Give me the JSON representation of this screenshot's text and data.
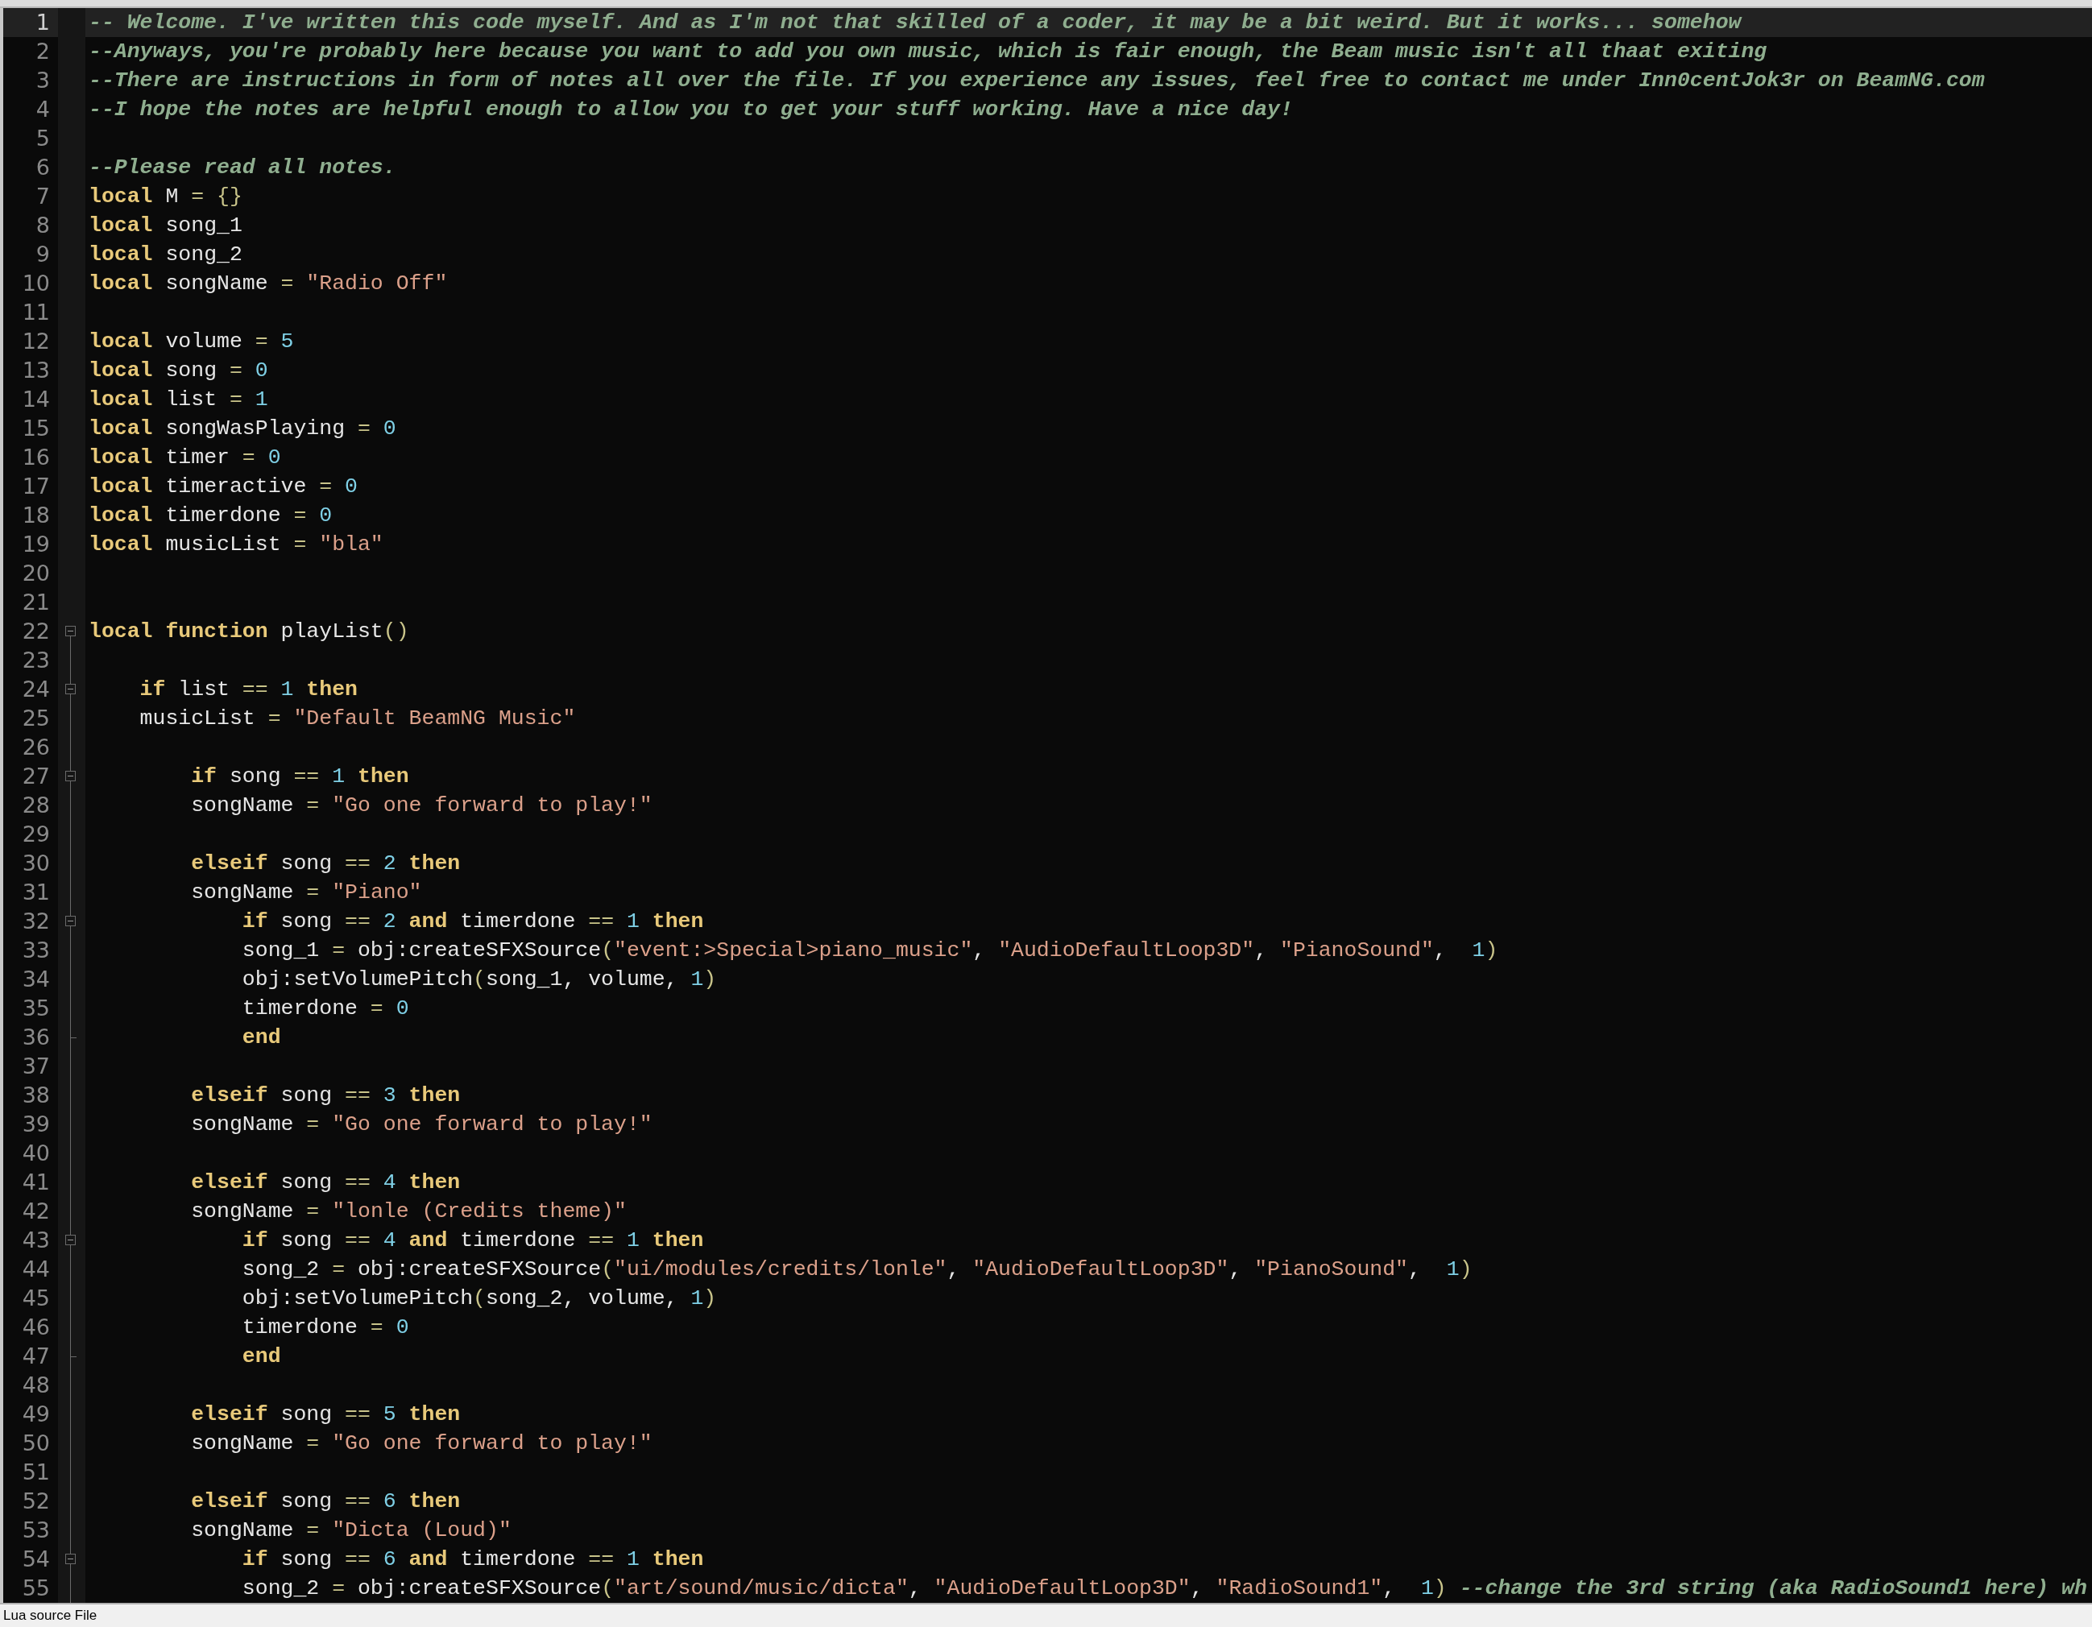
{
  "editor": {
    "lines": [
      {
        "number": "1",
        "current": true,
        "tokens": [
          {
            "kind": "comment",
            "text": "-- Welcome. I've written this code myself. And as I'm not that skilled of a coder, it may be a bit weird. But it works... somehow"
          }
        ]
      },
      {
        "number": "2",
        "current": false,
        "tokens": [
          {
            "kind": "comment",
            "text": "--Anyways, you're probably here because you want to add you own music, which is fair enough, the Beam music isn't all thaat exiting"
          }
        ]
      },
      {
        "number": "3",
        "current": false,
        "tokens": [
          {
            "kind": "comment",
            "text": "--There are instructions in form of notes all over the file. If you experience any issues, feel free to contact me under Inn0centJok3r on BeamNG.com"
          }
        ]
      },
      {
        "number": "4",
        "current": false,
        "tokens": [
          {
            "kind": "comment",
            "text": "--I hope the notes are helpful enough to allow you to get your stuff working. Have a nice day!"
          }
        ]
      },
      {
        "number": "5",
        "current": false
      },
      {
        "number": "6",
        "current": false,
        "tokens": [
          {
            "kind": "comment",
            "text": "--Please read all notes."
          }
        ]
      },
      {
        "number": "7",
        "current": false,
        "tokens": [
          {
            "kind": "keyword",
            "text": "local"
          },
          {
            "kind": "plain",
            "text": " M "
          },
          {
            "kind": "operator",
            "text": "= {}"
          }
        ]
      },
      {
        "number": "8",
        "current": false,
        "tokens": [
          {
            "kind": "keyword",
            "text": "local"
          },
          {
            "kind": "plain",
            "text": " song_1"
          }
        ]
      },
      {
        "number": "9",
        "current": false,
        "tokens": [
          {
            "kind": "keyword",
            "text": "local"
          },
          {
            "kind": "plain",
            "text": " song_2"
          }
        ]
      },
      {
        "number": "10",
        "current": false,
        "tokens": [
          {
            "kind": "keyword",
            "text": "local"
          },
          {
            "kind": "plain",
            "text": " songName "
          },
          {
            "kind": "operator",
            "text": "="
          },
          {
            "kind": "string",
            "text": " \"Radio Off\""
          }
        ]
      },
      {
        "number": "11",
        "current": false
      },
      {
        "number": "12",
        "current": false,
        "tokens": [
          {
            "kind": "keyword",
            "text": "local"
          },
          {
            "kind": "plain",
            "text": " volume "
          },
          {
            "kind": "operator",
            "text": "="
          },
          {
            "kind": "number",
            "text": " 5"
          }
        ]
      },
      {
        "number": "13",
        "current": false,
        "tokens": [
          {
            "kind": "keyword",
            "text": "local"
          },
          {
            "kind": "plain",
            "text": " song "
          },
          {
            "kind": "operator",
            "text": "="
          },
          {
            "kind": "number",
            "text": " 0"
          }
        ]
      },
      {
        "number": "14",
        "current": false,
        "tokens": [
          {
            "kind": "keyword",
            "text": "local"
          },
          {
            "kind": "plain",
            "text": " list "
          },
          {
            "kind": "operator",
            "text": "="
          },
          {
            "kind": "number",
            "text": " 1"
          }
        ]
      },
      {
        "number": "15",
        "current": false,
        "tokens": [
          {
            "kind": "keyword",
            "text": "local"
          },
          {
            "kind": "plain",
            "text": " songWasPlaying "
          },
          {
            "kind": "operator",
            "text": "="
          },
          {
            "kind": "number",
            "text": " 0"
          }
        ]
      },
      {
        "number": "16",
        "current": false,
        "tokens": [
          {
            "kind": "keyword",
            "text": "local"
          },
          {
            "kind": "plain",
            "text": " timer "
          },
          {
            "kind": "operator",
            "text": "="
          },
          {
            "kind": "number",
            "text": " 0"
          }
        ]
      },
      {
        "number": "17",
        "current": false,
        "tokens": [
          {
            "kind": "keyword",
            "text": "local"
          },
          {
            "kind": "plain",
            "text": " timeractive "
          },
          {
            "kind": "operator",
            "text": "="
          },
          {
            "kind": "number",
            "text": " 0"
          }
        ]
      },
      {
        "number": "18",
        "current": false,
        "tokens": [
          {
            "kind": "keyword",
            "text": "local"
          },
          {
            "kind": "plain",
            "text": " timerdone "
          },
          {
            "kind": "operator",
            "text": "="
          },
          {
            "kind": "number",
            "text": " 0"
          }
        ]
      },
      {
        "number": "19",
        "current": false,
        "tokens": [
          {
            "kind": "keyword",
            "text": "local"
          },
          {
            "kind": "plain",
            "text": " musicList "
          },
          {
            "kind": "operator",
            "text": "="
          },
          {
            "kind": "string",
            "text": " \"bla\""
          }
        ]
      },
      {
        "number": "20",
        "current": false
      },
      {
        "number": "21",
        "current": false
      },
      {
        "number": "22",
        "current": false,
        "kind": "fold_start",
        "tokens": [
          {
            "kind": "keyword",
            "text": "local function"
          },
          {
            "kind": "plain",
            "text": " playList"
          },
          {
            "kind": "operator",
            "text": "()"
          }
        ]
      },
      {
        "number": "23",
        "current": false
      },
      {
        "number": "24",
        "current": false,
        "kind": "fold_start",
        "tokens": [
          {
            "kind": "keyword",
            "text": "    if"
          },
          {
            "kind": "plain",
            "text": " list "
          },
          {
            "kind": "operator",
            "text": "=="
          },
          {
            "kind": "number",
            "text": " 1"
          },
          {
            "kind": "keyword",
            "text": " then"
          }
        ]
      },
      {
        "number": "25",
        "current": false,
        "tokens": [
          {
            "kind": "plain",
            "text": "    musicList "
          },
          {
            "kind": "operator",
            "text": "="
          },
          {
            "kind": "string",
            "text": " \"Default BeamNG Music\""
          }
        ]
      },
      {
        "number": "26",
        "current": false
      },
      {
        "number": "27",
        "current": false,
        "kind": "fold_start",
        "tokens": [
          {
            "kind": "keyword",
            "text": "        if"
          },
          {
            "kind": "plain",
            "text": " song "
          },
          {
            "kind": "operator",
            "text": "=="
          },
          {
            "kind": "number",
            "text": " 1"
          },
          {
            "kind": "keyword",
            "text": " then"
          }
        ]
      },
      {
        "number": "28",
        "current": false,
        "tokens": [
          {
            "kind": "plain",
            "text": "        songName "
          },
          {
            "kind": "operator",
            "text": "="
          },
          {
            "kind": "string",
            "text": " \"Go one forward to play!\""
          }
        ]
      },
      {
        "number": "29",
        "current": false
      },
      {
        "number": "30",
        "current": false,
        "tokens": [
          {
            "kind": "keyword",
            "text": "        elseif"
          },
          {
            "kind": "plain",
            "text": " song "
          },
          {
            "kind": "operator",
            "text": "=="
          },
          {
            "kind": "number",
            "text": " 2"
          },
          {
            "kind": "keyword",
            "text": " then"
          }
        ]
      },
      {
        "number": "31",
        "current": false,
        "tokens": [
          {
            "kind": "plain",
            "text": "        songName "
          },
          {
            "kind": "operator",
            "text": "="
          },
          {
            "kind": "string",
            "text": " \"Piano\""
          }
        ]
      },
      {
        "number": "32",
        "current": false,
        "kind": "fold_start",
        "tokens": [
          {
            "kind": "keyword",
            "text": "            if"
          },
          {
            "kind": "plain",
            "text": " song "
          },
          {
            "kind": "operator",
            "text": "=="
          },
          {
            "kind": "number",
            "text": " 2"
          },
          {
            "kind": "keyword",
            "text": " and"
          },
          {
            "kind": "plain",
            "text": " timerdone "
          },
          {
            "kind": "operator",
            "text": "=="
          },
          {
            "kind": "number",
            "text": " 1"
          },
          {
            "kind": "keyword",
            "text": " then"
          }
        ]
      },
      {
        "number": "33",
        "current": false,
        "tokens": [
          {
            "kind": "plain",
            "text": "            song_1 "
          },
          {
            "kind": "operator",
            "text": "="
          },
          {
            "kind": "plain",
            "text": " obj:createSFXSource"
          },
          {
            "kind": "operator",
            "text": "("
          },
          {
            "kind": "string",
            "text": "\"event:>Special>piano_music\""
          },
          {
            "kind": "plain",
            "text": ", "
          },
          {
            "kind": "string",
            "text": "\"AudioDefaultLoop3D\""
          },
          {
            "kind": "plain",
            "text": ", "
          },
          {
            "kind": "string",
            "text": "\"PianoSound\""
          },
          {
            "kind": "plain",
            "text": ",  "
          },
          {
            "kind": "number",
            "text": "1"
          },
          {
            "kind": "operator",
            "text": ")"
          }
        ]
      },
      {
        "number": "34",
        "current": false,
        "tokens": [
          {
            "kind": "plain",
            "text": "            obj:setVolumePitch"
          },
          {
            "kind": "operator",
            "text": "("
          },
          {
            "kind": "plain",
            "text": "song_1, volume, "
          },
          {
            "kind": "number",
            "text": "1"
          },
          {
            "kind": "operator",
            "text": ")"
          }
        ]
      },
      {
        "number": "35",
        "current": false,
        "tokens": [
          {
            "kind": "plain",
            "text": "            timerdone "
          },
          {
            "kind": "operator",
            "text": "="
          },
          {
            "kind": "number",
            "text": " 0"
          }
        ]
      },
      {
        "number": "36",
        "current": false,
        "kind": "fold_end",
        "tokens": [
          {
            "kind": "keyword",
            "text": "            end"
          }
        ]
      },
      {
        "number": "37",
        "current": false
      },
      {
        "number": "38",
        "current": false,
        "tokens": [
          {
            "kind": "keyword",
            "text": "        elseif"
          },
          {
            "kind": "plain",
            "text": " song "
          },
          {
            "kind": "operator",
            "text": "=="
          },
          {
            "kind": "number",
            "text": " 3"
          },
          {
            "kind": "keyword",
            "text": " then"
          }
        ]
      },
      {
        "number": "39",
        "current": false,
        "tokens": [
          {
            "kind": "plain",
            "text": "        songName "
          },
          {
            "kind": "operator",
            "text": "="
          },
          {
            "kind": "string",
            "text": " \"Go one forward to play!\""
          }
        ]
      },
      {
        "number": "40",
        "current": false
      },
      {
        "number": "41",
        "current": false,
        "tokens": [
          {
            "kind": "keyword",
            "text": "        elseif"
          },
          {
            "kind": "plain",
            "text": " song "
          },
          {
            "kind": "operator",
            "text": "=="
          },
          {
            "kind": "number",
            "text": " 4"
          },
          {
            "kind": "keyword",
            "text": " then"
          }
        ]
      },
      {
        "number": "42",
        "current": false,
        "tokens": [
          {
            "kind": "plain",
            "text": "        songName "
          },
          {
            "kind": "operator",
            "text": "="
          },
          {
            "kind": "string",
            "text": " \"lonle (Credits theme)\""
          }
        ]
      },
      {
        "number": "43",
        "current": false,
        "kind": "fold_start",
        "tokens": [
          {
            "kind": "keyword",
            "text": "            if"
          },
          {
            "kind": "plain",
            "text": " song "
          },
          {
            "kind": "operator",
            "text": "=="
          },
          {
            "kind": "number",
            "text": " 4"
          },
          {
            "kind": "keyword",
            "text": " and"
          },
          {
            "kind": "plain",
            "text": " timerdone "
          },
          {
            "kind": "operator",
            "text": "=="
          },
          {
            "kind": "number",
            "text": " 1"
          },
          {
            "kind": "keyword",
            "text": " then"
          }
        ]
      },
      {
        "number": "44",
        "current": false,
        "tokens": [
          {
            "kind": "plain",
            "text": "            song_2 "
          },
          {
            "kind": "operator",
            "text": "="
          },
          {
            "kind": "plain",
            "text": " obj:createSFXSource"
          },
          {
            "kind": "operator",
            "text": "("
          },
          {
            "kind": "string",
            "text": "\"ui/modules/credits/lonle\""
          },
          {
            "kind": "plain",
            "text": ", "
          },
          {
            "kind": "string",
            "text": "\"AudioDefaultLoop3D\""
          },
          {
            "kind": "plain",
            "text": ", "
          },
          {
            "kind": "string",
            "text": "\"PianoSound\""
          },
          {
            "kind": "plain",
            "text": ",  "
          },
          {
            "kind": "number",
            "text": "1"
          },
          {
            "kind": "operator",
            "text": ")"
          }
        ]
      },
      {
        "number": "45",
        "current": false,
        "tokens": [
          {
            "kind": "plain",
            "text": "            obj:setVolumePitch"
          },
          {
            "kind": "operator",
            "text": "("
          },
          {
            "kind": "plain",
            "text": "song_2, volume, "
          },
          {
            "kind": "number",
            "text": "1"
          },
          {
            "kind": "operator",
            "text": ")"
          }
        ]
      },
      {
        "number": "46",
        "current": false,
        "tokens": [
          {
            "kind": "plain",
            "text": "            timerdone "
          },
          {
            "kind": "operator",
            "text": "="
          },
          {
            "kind": "number",
            "text": " 0"
          }
        ]
      },
      {
        "number": "47",
        "current": false,
        "kind": "fold_end",
        "tokens": [
          {
            "kind": "keyword",
            "text": "            end"
          }
        ]
      },
      {
        "number": "48",
        "current": false
      },
      {
        "number": "49",
        "current": false,
        "tokens": [
          {
            "kind": "keyword",
            "text": "        elseif"
          },
          {
            "kind": "plain",
            "text": " song "
          },
          {
            "kind": "operator",
            "text": "=="
          },
          {
            "kind": "number",
            "text": " 5"
          },
          {
            "kind": "keyword",
            "text": " then"
          }
        ]
      },
      {
        "number": "50",
        "current": false,
        "tokens": [
          {
            "kind": "plain",
            "text": "        songName "
          },
          {
            "kind": "operator",
            "text": "="
          },
          {
            "kind": "string",
            "text": " \"Go one forward to play!\""
          }
        ]
      },
      {
        "number": "51",
        "current": false
      },
      {
        "number": "52",
        "current": false,
        "tokens": [
          {
            "kind": "keyword",
            "text": "        elseif"
          },
          {
            "kind": "plain",
            "text": " song "
          },
          {
            "kind": "operator",
            "text": "=="
          },
          {
            "kind": "number",
            "text": " 6"
          },
          {
            "kind": "keyword",
            "text": " then"
          }
        ]
      },
      {
        "number": "53",
        "current": false,
        "tokens": [
          {
            "kind": "plain",
            "text": "        songName "
          },
          {
            "kind": "operator",
            "text": "="
          },
          {
            "kind": "string",
            "text": " \"Dicta (Loud)\""
          }
        ]
      },
      {
        "number": "54",
        "current": false,
        "kind": "fold_start",
        "tokens": [
          {
            "kind": "keyword",
            "text": "            if"
          },
          {
            "kind": "plain",
            "text": " song "
          },
          {
            "kind": "operator",
            "text": "=="
          },
          {
            "kind": "number",
            "text": " 6"
          },
          {
            "kind": "keyword",
            "text": " and"
          },
          {
            "kind": "plain",
            "text": " timerdone "
          },
          {
            "kind": "operator",
            "text": "=="
          },
          {
            "kind": "number",
            "text": " 1"
          },
          {
            "kind": "keyword",
            "text": " then"
          }
        ]
      },
      {
        "number": "55",
        "current": false,
        "tokens": [
          {
            "kind": "plain",
            "text": "            song_2 "
          },
          {
            "kind": "operator",
            "text": "="
          },
          {
            "kind": "plain",
            "text": " obj:createSFXSource"
          },
          {
            "kind": "operator",
            "text": "("
          },
          {
            "kind": "string",
            "text": "\"art/sound/music/dicta\""
          },
          {
            "kind": "plain",
            "text": ", "
          },
          {
            "kind": "string",
            "text": "\"AudioDefaultLoop3D\""
          },
          {
            "kind": "plain",
            "text": ", "
          },
          {
            "kind": "string",
            "text": "\"RadioSound1\""
          },
          {
            "kind": "plain",
            "text": ",  "
          },
          {
            "kind": "number",
            "text": "1"
          },
          {
            "kind": "operator",
            "text": ")"
          },
          {
            "kind": "comment",
            "text": " --change the 3rd string (aka RadioSound1 here) wh"
          }
        ]
      }
    ]
  },
  "status_bar": {
    "file_type": "Lua source File"
  }
}
